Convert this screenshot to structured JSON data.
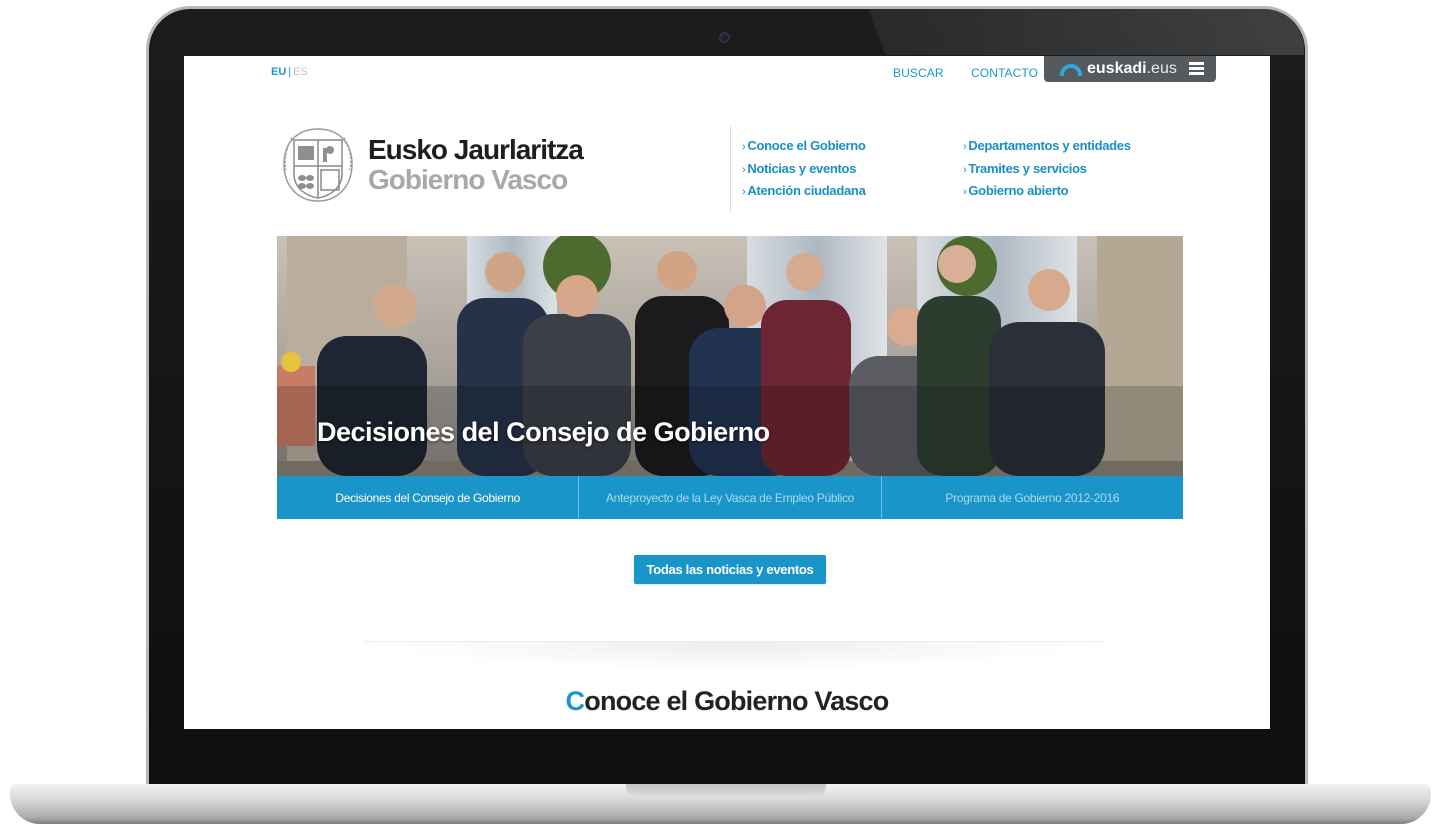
{
  "topbar": {
    "lang_active": "EU",
    "lang_separator": "|",
    "lang_inactive": "ES",
    "search_label": "BUSCAR",
    "contact_label": "CONTACTO",
    "portal_name": "euskadi",
    "portal_tld": ".eus"
  },
  "brand": {
    "name_eu": "Eusko Jaurlaritza",
    "name_es": "Gobierno Vasco"
  },
  "nav": {
    "col1": [
      "Conoce el Gobierno",
      "Noticias y eventos",
      "Atención ciudadana"
    ],
    "col2": [
      "Departamentos y entidades",
      "Tramites y servicios",
      "Gobierno abierto"
    ],
    "chevron": "›"
  },
  "hero": {
    "caption": "Decisiones del Consejo de Gobierno"
  },
  "tabs": [
    {
      "label": "Decisiones del Consejo de Gobierno",
      "active": true
    },
    {
      "label": "Anteproyecto de la Ley Vasca de Empleo Público",
      "active": false
    },
    {
      "label": "Programa de Gobierno 2012-2016",
      "active": false
    }
  ],
  "all_news_button": "Todas las noticias y eventos",
  "section": {
    "title_first_letter": "C",
    "title_rest": "onoce el Gobierno Vasco"
  },
  "colors": {
    "accent": "#1a95ca",
    "portal_tab": "#555a5f",
    "brand_dark": "#1e1e1e",
    "brand_gray": "#a8a8a8"
  }
}
